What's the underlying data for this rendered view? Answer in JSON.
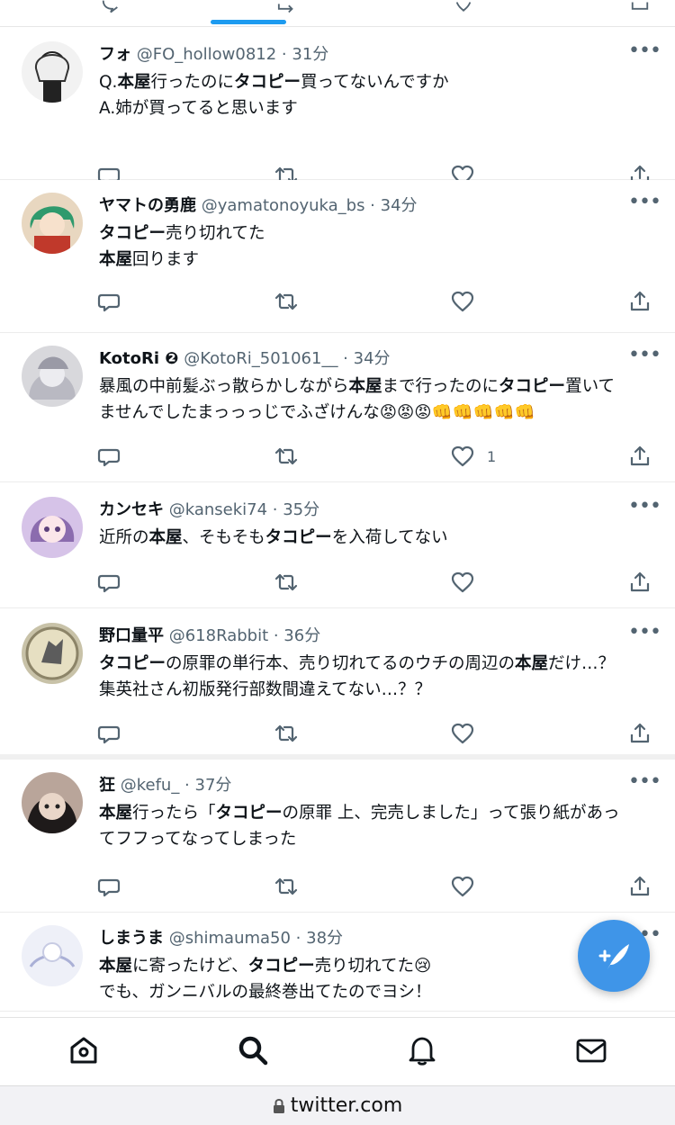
{
  "tweets": [
    {
      "name": "フォ",
      "handle": "@FO_hollow0812 · 31分",
      "lines": [
        "Q.<b>本屋</b>行ったのに<b>タコピー</b>買ってないんですか",
        "A.姉が買ってると思います"
      ],
      "like_count": ""
    },
    {
      "name": "ヤマトの勇鹿",
      "handle": "@yamatonoyuka_bs · 34分",
      "lines": [
        "<b>タコピー</b>売り切れてた",
        "<b>本屋</b>回ります"
      ],
      "like_count": ""
    },
    {
      "name": "KotoRi ❷",
      "handle": "@KotoRi_501061__ · 34分",
      "lines": [
        "暴風の中前髪ぶっ散らかしながら<b>本屋</b>まで行ったのに<b>タコピー</b>置いて",
        "ませんでしたまっっっじでふざけんな😡😡😡👊👊👊👊👊"
      ],
      "like_count": "1"
    },
    {
      "name": "カンセキ",
      "handle": "@kanseki74 · 35分",
      "lines": [
        "近所の<b>本屋</b>、そもそも<b>タコピー</b>を入荷してない"
      ],
      "like_count": ""
    },
    {
      "name": "野口量平",
      "handle": "@618Rabbit · 36分",
      "lines": [
        "<b>タコピー</b>の原罪の単行本、売り切れてるのウチの周辺の<b>本屋</b>だけ…？",
        "集英社さん初版発行部数間違えてない…？？"
      ],
      "like_count": ""
    },
    {
      "name": "狂",
      "handle": "@kefu_ · 37分",
      "lines": [
        "<b>本屋</b>行ったら「<b>タコピー</b>の原罪 上、完売しました」って張り紙があっ",
        "てフフってなってしまった"
      ],
      "like_count": ""
    },
    {
      "name": "しまうま",
      "handle": "@shimauma50 · 38分",
      "lines": [
        "<b>本屋</b>に寄ったけど、<b>タコピー</b>売り切れてた😢",
        "でも、ガンニバルの最終巻出てたのでヨシ！"
      ],
      "like_count": ""
    }
  ],
  "more_glyph": "•••",
  "url": "twitter.com",
  "icons": {
    "reply": "reply-icon",
    "retweet": "retweet-icon",
    "like": "heart-icon",
    "share": "share-icon",
    "home": "home-icon",
    "search": "search-icon",
    "notifications": "bell-icon",
    "messages": "mail-icon",
    "compose": "compose-tweet-icon",
    "lock": "lock-icon"
  },
  "colors": {
    "accent": "#1d9bf0",
    "fab": "#3f95e8",
    "meta": "#536471",
    "text": "#0f1419"
  }
}
